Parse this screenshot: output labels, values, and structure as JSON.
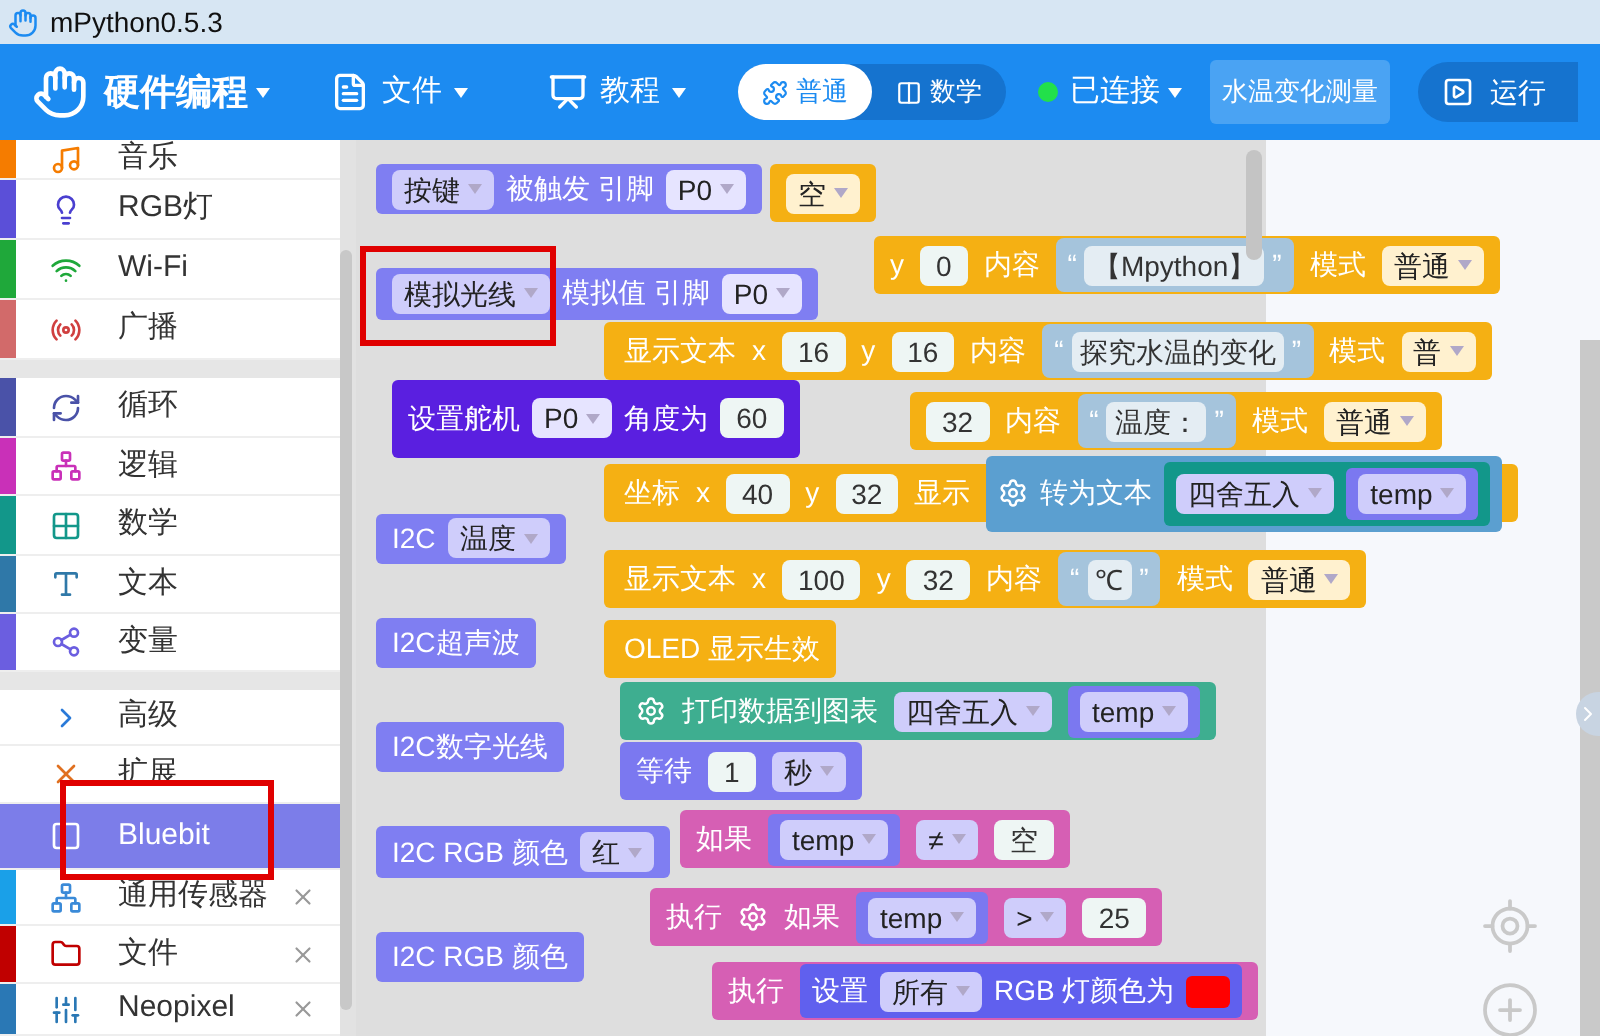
{
  "window": {
    "title": "mPython0.5.3"
  },
  "header": {
    "app_name": "硬件编程",
    "menus": [
      "文件",
      "教程"
    ],
    "mode_toggle": [
      {
        "label": "普通",
        "selected": true
      },
      {
        "label": "数学",
        "selected": false
      }
    ],
    "connection": {
      "label": "已连接",
      "connected": true
    },
    "project_name": "水温变化测量",
    "run_label": "运行"
  },
  "sidebar": {
    "groups": [
      [
        {
          "label": "音乐",
          "color": "#f57c00",
          "selected": false,
          "closable": false
        },
        {
          "label": "RGB灯",
          "color": "#5b4fd8",
          "selected": false,
          "closable": false
        },
        {
          "label": "Wi-Fi",
          "color": "#1fa83a",
          "selected": false,
          "closable": false
        },
        {
          "label": "广播",
          "color": "#d26a6a",
          "selected": false,
          "closable": false
        }
      ],
      [
        {
          "label": "循环",
          "color": "#4a52a8",
          "selected": false,
          "closable": false
        },
        {
          "label": "逻辑",
          "color": "#c930b8",
          "selected": false,
          "closable": false
        },
        {
          "label": "数学",
          "color": "#12978a",
          "selected": false,
          "closable": false
        },
        {
          "label": "文本",
          "color": "#2f78a8",
          "selected": false,
          "closable": false
        },
        {
          "label": "变量",
          "color": "#6b5ee0",
          "selected": false,
          "closable": false
        }
      ],
      [
        {
          "label": "高级",
          "selected": false,
          "closable": false
        },
        {
          "label": "扩展",
          "selected": false,
          "closable": false
        },
        {
          "label": "Bluebit",
          "selected": true,
          "closable": false
        },
        {
          "label": "通用传感器",
          "color": "#1aa0e8",
          "selected": false,
          "closable": true
        },
        {
          "label": "文件",
          "color": "#c00000",
          "selected": false,
          "closable": true
        },
        {
          "label": "Neopixel",
          "color": "#2a78b5",
          "selected": false,
          "closable": true
        }
      ]
    ]
  },
  "flyout_blocks": [
    {
      "kind": "sensor",
      "items": [
        {
          "kind": "dd",
          "text": "按键"
        },
        {
          "kind": "label",
          "text": "被触发 引脚"
        },
        {
          "kind": "dd",
          "text": "P0",
          "socket": true
        }
      ]
    },
    {
      "kind": "sensor",
      "items": [
        {
          "kind": "dd",
          "text": "模拟光线"
        },
        {
          "kind": "label",
          "text": "模拟值 引脚"
        },
        {
          "kind": "dd",
          "text": "P0",
          "socket": true
        }
      ]
    },
    {
      "kind": "servo",
      "items": [
        {
          "kind": "label",
          "text": "设置舵机"
        },
        {
          "kind": "dd",
          "text": "P0",
          "socket": true
        },
        {
          "kind": "label",
          "text": "角度为"
        },
        {
          "kind": "num",
          "text": "60"
        }
      ]
    },
    {
      "kind": "sensor",
      "items": [
        {
          "kind": "label",
          "text": "I2C"
        },
        {
          "kind": "dd",
          "text": "温度"
        }
      ]
    },
    {
      "kind": "sensor",
      "items": [
        {
          "kind": "label",
          "text": "I2C超声波"
        }
      ]
    },
    {
      "kind": "sensor",
      "items": [
        {
          "kind": "label",
          "text": "I2C数字光线"
        }
      ]
    },
    {
      "kind": "sensor",
      "items": [
        {
          "kind": "label",
          "text": "I2C RGB 颜色"
        },
        {
          "kind": "dd",
          "text": "红"
        }
      ]
    },
    {
      "kind": "sensor",
      "items": [
        {
          "kind": "label",
          "text": "I2C RGB 颜色"
        }
      ]
    }
  ],
  "workspace_blocks": [
    {
      "color": "#f5b013",
      "items": [
        {
          "kind": "dd",
          "text": "空"
        }
      ]
    },
    {
      "color": "#f5b013",
      "items": [
        {
          "kind": "label",
          "text": "y"
        },
        {
          "kind": "num",
          "text": "0"
        },
        {
          "kind": "label",
          "text": "内容"
        },
        {
          "kind": "str",
          "open": "“",
          "text": "【Mpython】",
          "close": "”"
        },
        {
          "kind": "label",
          "text": "模式"
        },
        {
          "kind": "dd",
          "text": "普通"
        }
      ]
    },
    {
      "color": "#f5b013",
      "items": [
        {
          "kind": "label",
          "text": "显示文本"
        },
        {
          "kind": "label",
          "text": "x"
        },
        {
          "kind": "num",
          "text": "16"
        },
        {
          "kind": "label",
          "text": "y"
        },
        {
          "kind": "num",
          "text": "16"
        },
        {
          "kind": "label",
          "text": "内容"
        },
        {
          "kind": "str",
          "open": "“",
          "text": "探究水温的变化",
          "close": "”"
        },
        {
          "kind": "label",
          "text": "模式"
        },
        {
          "kind": "dd",
          "text": "普"
        }
      ]
    },
    {
      "color": "#f5b013",
      "items": [
        {
          "kind": "num",
          "text": "32"
        },
        {
          "kind": "label",
          "text": "内容"
        },
        {
          "kind": "str",
          "open": "“",
          "text": "温度：",
          "close": "”"
        },
        {
          "kind": "label",
          "text": "模式"
        },
        {
          "kind": "dd",
          "text": "普通"
        }
      ]
    },
    {
      "color": "#f5b013",
      "items": [
        {
          "kind": "label",
          "text": "坐标"
        },
        {
          "kind": "label",
          "text": "x"
        },
        {
          "kind": "num",
          "text": "40"
        },
        {
          "kind": "label",
          "text": "y"
        },
        {
          "kind": "num",
          "text": "32"
        },
        {
          "kind": "label",
          "text": "显示"
        },
        {
          "kind": "sub",
          "color": "#5b9fd0",
          "items": [
            {
              "kind": "gear"
            },
            {
              "kind": "label",
              "text": "转为文本"
            },
            {
              "kind": "sub",
              "color": "#12978a",
              "items": [
                {
                  "kind": "dd",
                  "text": "四舍五入"
                },
                {
                  "kind": "sub",
                  "color": "#7b78f0",
                  "items": [
                    {
                      "kind": "dd",
                      "text": "temp"
                    }
                  ]
                }
              ]
            }
          ]
        }
      ]
    },
    {
      "color": "#f5b013",
      "items": [
        {
          "kind": "label",
          "text": "显示文本"
        },
        {
          "kind": "label",
          "text": "x"
        },
        {
          "kind": "num",
          "text": "100"
        },
        {
          "kind": "label",
          "text": "y"
        },
        {
          "kind": "num",
          "text": "32"
        },
        {
          "kind": "label",
          "text": "内容"
        },
        {
          "kind": "str",
          "open": "“",
          "text": "℃",
          "close": "”"
        },
        {
          "kind": "label",
          "text": "模式"
        },
        {
          "kind": "dd",
          "text": "普通"
        }
      ]
    },
    {
      "color": "#f5b013",
      "items": [
        {
          "kind": "label",
          "text": "OLED 显示生效"
        }
      ]
    },
    {
      "color": "#3eae90",
      "items": [
        {
          "kind": "gear"
        },
        {
          "kind": "label",
          "text": "打印数据到图表"
        },
        {
          "kind": "dd",
          "text": "四舍五入"
        },
        {
          "kind": "sub",
          "color": "#7b78f0",
          "items": [
            {
              "kind": "dd",
              "text": "temp"
            }
          ]
        }
      ]
    },
    {
      "color": "#7b78f0",
      "items": [
        {
          "kind": "label",
          "text": "等待"
        },
        {
          "kind": "num",
          "text": "1"
        },
        {
          "kind": "dd",
          "text": "秒"
        }
      ]
    },
    {
      "color": "#d65fb4",
      "items": [
        {
          "kind": "label",
          "text": "如果"
        },
        {
          "kind": "sub",
          "color": "#7b78f0",
          "items": [
            {
              "kind": "dd",
              "text": "temp"
            }
          ]
        },
        {
          "kind": "dd",
          "text": "≠"
        },
        {
          "kind": "num",
          "text": "空"
        }
      ]
    },
    {
      "color": "#d65fb4",
      "items": [
        {
          "kind": "label",
          "text": "执行"
        },
        {
          "kind": "gear"
        },
        {
          "kind": "label",
          "text": "如果"
        },
        {
          "kind": "sub",
          "color": "#7b78f0",
          "items": [
            {
              "kind": "dd",
              "text": "temp"
            }
          ]
        },
        {
          "kind": "dd",
          "text": ">"
        },
        {
          "kind": "num",
          "text": "25"
        }
      ]
    },
    {
      "color": "#d65fb4",
      "items": [
        {
          "kind": "label",
          "text": "执行"
        },
        {
          "kind": "sub",
          "color": "#6060ee",
          "items": [
            {
              "kind": "label",
              "text": "设置"
            },
            {
              "kind": "dd",
              "text": "所有"
            },
            {
              "kind": "label",
              "text": "RGB 灯颜色为"
            },
            {
              "kind": "swatch",
              "color": "#ff0000"
            }
          ]
        }
      ]
    }
  ]
}
